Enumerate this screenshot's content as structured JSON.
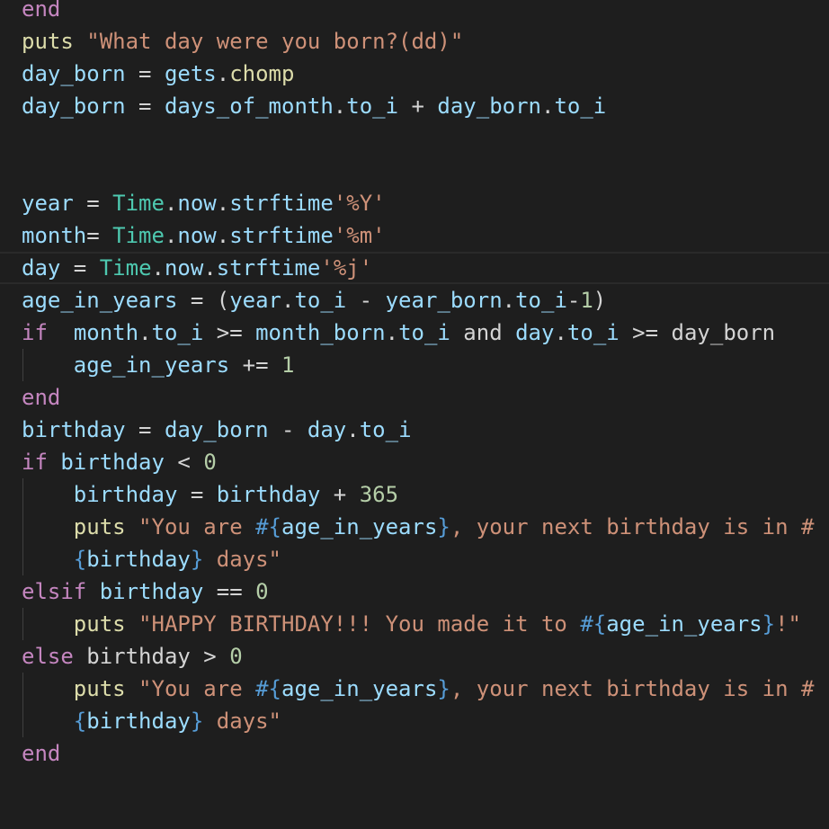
{
  "colors": {
    "background": "#1e1e1e",
    "default": "#d4d4d4",
    "keyword": "#c586c0",
    "control": "#569cd6",
    "variable": "#9cdcfe",
    "method": "#dcdcaa",
    "string": "#ce9178",
    "number": "#b5cea8",
    "constant": "#4ec9b0",
    "operator": "#d4d4d4"
  },
  "code_lines": [
    [
      [
        "end",
        "keyword"
      ]
    ],
    [
      [
        "puts ",
        "method"
      ],
      [
        "\"What day were you born?(dd)\"",
        "string"
      ]
    ],
    [
      [
        "day_born",
        "variable"
      ],
      [
        " = ",
        "operator"
      ],
      [
        "gets",
        "variable"
      ],
      [
        ".",
        "operator"
      ],
      [
        "chomp",
        "method"
      ]
    ],
    [
      [
        "day_born",
        "variable"
      ],
      [
        " = ",
        "operator"
      ],
      [
        "days_of_month",
        "variable"
      ],
      [
        ".",
        "operator"
      ],
      [
        "to_i",
        "variable"
      ],
      [
        " + ",
        "operator"
      ],
      [
        "day_born",
        "variable"
      ],
      [
        ".",
        "operator"
      ],
      [
        "to_i",
        "variable"
      ]
    ],
    [],
    [],
    [
      [
        "year",
        "variable"
      ],
      [
        " = ",
        "operator"
      ],
      [
        "Time",
        "constant"
      ],
      [
        ".",
        "operator"
      ],
      [
        "now",
        "variable"
      ],
      [
        ".",
        "operator"
      ],
      [
        "strftime",
        "variable"
      ],
      [
        "'%Y'",
        "string"
      ]
    ],
    [
      [
        "month",
        "variable"
      ],
      [
        "= ",
        "operator"
      ],
      [
        "Time",
        "constant"
      ],
      [
        ".",
        "operator"
      ],
      [
        "now",
        "variable"
      ],
      [
        ".",
        "operator"
      ],
      [
        "strftime",
        "variable"
      ],
      [
        "'%m'",
        "string"
      ]
    ],
    [
      [
        "day",
        "variable"
      ],
      [
        " = ",
        "operator"
      ],
      [
        "Time",
        "constant"
      ],
      [
        ".",
        "operator"
      ],
      [
        "now",
        "variable"
      ],
      [
        ".",
        "operator"
      ],
      [
        "strftime",
        "variable"
      ],
      [
        "'%j'",
        "string"
      ]
    ],
    [
      [
        "age_in_years",
        "variable"
      ],
      [
        " = (",
        "operator"
      ],
      [
        "year",
        "variable"
      ],
      [
        ".",
        "operator"
      ],
      [
        "to_i",
        "variable"
      ],
      [
        " - ",
        "operator"
      ],
      [
        "year_born",
        "variable"
      ],
      [
        ".",
        "operator"
      ],
      [
        "to_i",
        "variable"
      ],
      [
        "-",
        "operator"
      ],
      [
        "1",
        "number"
      ],
      [
        ")",
        "operator"
      ]
    ],
    [
      [
        "if",
        "keyword"
      ],
      [
        "  ",
        "operator"
      ],
      [
        "month",
        "variable"
      ],
      [
        ".",
        "operator"
      ],
      [
        "to_i",
        "variable"
      ],
      [
        " >= ",
        "operator"
      ],
      [
        "month_born",
        "variable"
      ],
      [
        ".",
        "operator"
      ],
      [
        "to_i",
        "variable"
      ],
      [
        " and ",
        "operator"
      ],
      [
        "day",
        "variable"
      ],
      [
        ".",
        "operator"
      ],
      [
        "to_i",
        "variable"
      ],
      [
        " >= ",
        "operator"
      ],
      [
        "day_born",
        "operator"
      ]
    ],
    [
      [
        "    ",
        "operator"
      ],
      [
        "age_in_years",
        "variable"
      ],
      [
        " += ",
        "operator"
      ],
      [
        "1",
        "number"
      ]
    ],
    [
      [
        "end",
        "keyword"
      ]
    ],
    [
      [
        "birthday",
        "variable"
      ],
      [
        " = ",
        "operator"
      ],
      [
        "day_born",
        "variable"
      ],
      [
        " - ",
        "operator"
      ],
      [
        "day",
        "variable"
      ],
      [
        ".",
        "operator"
      ],
      [
        "to_i",
        "variable"
      ]
    ],
    [
      [
        "if",
        "keyword"
      ],
      [
        " ",
        "operator"
      ],
      [
        "birthday",
        "variable"
      ],
      [
        " < ",
        "operator"
      ],
      [
        "0",
        "number"
      ]
    ],
    [
      [
        "    ",
        "operator"
      ],
      [
        "birthday",
        "variable"
      ],
      [
        " = ",
        "operator"
      ],
      [
        "birthday",
        "variable"
      ],
      [
        " + ",
        "operator"
      ],
      [
        "365",
        "number"
      ]
    ],
    [
      [
        "    ",
        "operator"
      ],
      [
        "puts ",
        "method"
      ],
      [
        "\"You are ",
        "string"
      ],
      [
        "#{",
        "control"
      ],
      [
        "age_in_years",
        "variable"
      ],
      [
        "}",
        "control"
      ],
      [
        ", your next birthday is in #",
        "string"
      ]
    ],
    [
      [
        "    ",
        "operator"
      ],
      [
        "{",
        "control"
      ],
      [
        "birthday",
        "variable"
      ],
      [
        "}",
        "control"
      ],
      [
        " days\"",
        "string"
      ]
    ],
    [
      [
        "elsif",
        "keyword"
      ],
      [
        " ",
        "operator"
      ],
      [
        "birthday",
        "variable"
      ],
      [
        " == ",
        "operator"
      ],
      [
        "0",
        "number"
      ]
    ],
    [
      [
        "    ",
        "operator"
      ],
      [
        "puts ",
        "method"
      ],
      [
        "\"HAPPY BIRTHDAY!!! You made it to ",
        "string"
      ],
      [
        "#{",
        "control"
      ],
      [
        "age_in_years",
        "variable"
      ],
      [
        "}",
        "control"
      ],
      [
        "!\"",
        "string"
      ]
    ],
    [
      [
        "else",
        "keyword"
      ],
      [
        " ",
        "operator"
      ],
      [
        "birthday",
        "operator"
      ],
      [
        " > ",
        "operator"
      ],
      [
        "0",
        "number"
      ]
    ],
    [
      [
        "    ",
        "operator"
      ],
      [
        "puts ",
        "method"
      ],
      [
        "\"You are ",
        "string"
      ],
      [
        "#{",
        "control"
      ],
      [
        "age_in_years",
        "variable"
      ],
      [
        "}",
        "control"
      ],
      [
        ", your next birthday is in #",
        "string"
      ]
    ],
    [
      [
        "    ",
        "operator"
      ],
      [
        "{",
        "control"
      ],
      [
        "birthday",
        "variable"
      ],
      [
        "}",
        "control"
      ],
      [
        " days\"",
        "string"
      ]
    ],
    [
      [
        "end",
        "keyword"
      ]
    ]
  ]
}
